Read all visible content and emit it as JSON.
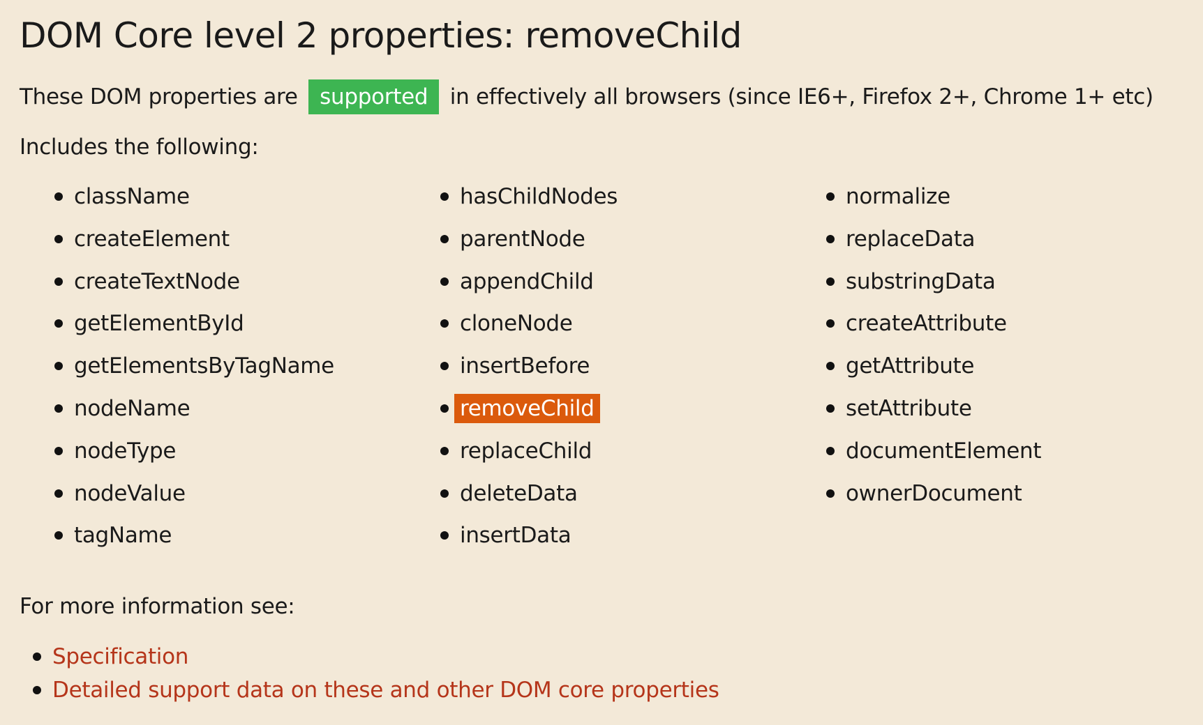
{
  "page": {
    "title": "DOM Core level 2 properties: removeChild"
  },
  "intro": {
    "before": "These DOM properties are",
    "badge": "supported",
    "after": "in effectively all browsers (since IE6+, Firefox 2+, Chrome 1+ etc)",
    "badge_color": "#3db552"
  },
  "includes_label": "Includes the following:",
  "columns": [
    {
      "items": [
        "className",
        "createElement",
        "createTextNode",
        "getElementById",
        "getElementsByTagName",
        "nodeName",
        "nodeType",
        "nodeValue",
        "tagName"
      ]
    },
    {
      "items": [
        "hasChildNodes",
        "parentNode",
        "appendChild",
        "cloneNode",
        "insertBefore",
        "removeChild",
        "replaceChild",
        "deleteData",
        "insertData"
      ]
    },
    {
      "items": [
        "normalize",
        "replaceData",
        "substringData",
        "createAttribute",
        "getAttribute",
        "setAttribute",
        "documentElement",
        "ownerDocument"
      ]
    }
  ],
  "highlighted_item": "removeChild",
  "highlight_color": "#db5a0c",
  "more_info": {
    "label": "For more information see:",
    "links": [
      "Specification",
      "Detailed support data on these and other DOM core properties"
    ],
    "link_color": "#b5351a"
  }
}
